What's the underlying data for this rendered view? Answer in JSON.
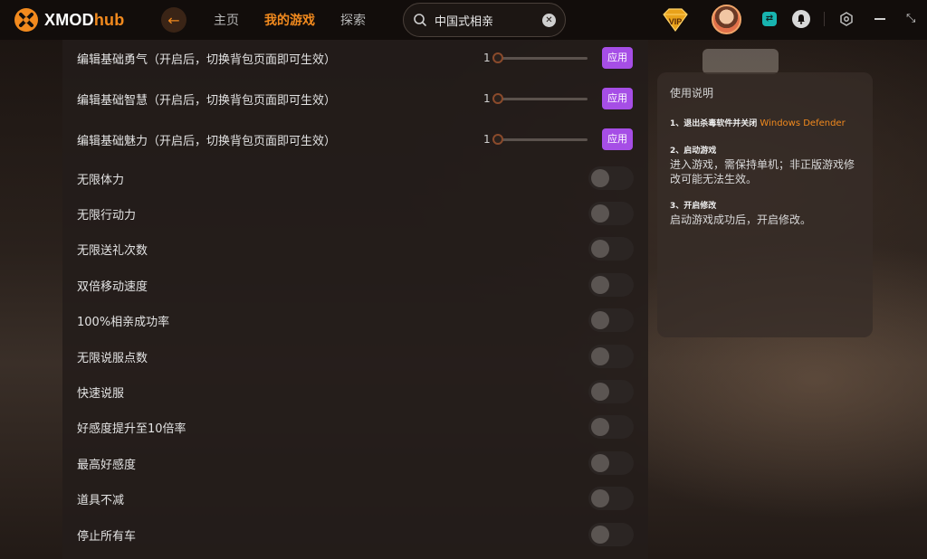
{
  "app": {
    "logo_text": "XMOD",
    "logo_hub": "hub",
    "accent_color": "#f28a1e"
  },
  "nav": {
    "items": [
      {
        "label": "主页",
        "active": false
      },
      {
        "label": "我的游戏",
        "active": true
      },
      {
        "label": "探索",
        "active": false
      }
    ]
  },
  "search": {
    "value": "中国式相亲",
    "clear_glyph": "✕"
  },
  "topbar": {
    "back_glyph": "←",
    "vip_label": "VIP",
    "sync_glyph": "⇄",
    "maximize_glyph": "⤡"
  },
  "sliders": [
    {
      "label": "编辑基础勇气（开启后，切换背包页面即可生效）",
      "value": "1",
      "apply": "应用"
    },
    {
      "label": "编辑基础智慧（开启后，切换背包页面即可生效）",
      "value": "1",
      "apply": "应用"
    },
    {
      "label": "编辑基础魅力（开启后，切换背包页面即可生效）",
      "value": "1",
      "apply": "应用"
    }
  ],
  "toggles": [
    {
      "label": "无限体力",
      "on": false
    },
    {
      "label": "无限行动力",
      "on": false
    },
    {
      "label": "无限送礼次数",
      "on": false
    },
    {
      "label": "双倍移动速度",
      "on": false
    },
    {
      "label": "100%相亲成功率",
      "on": false
    },
    {
      "label": "无限说服点数",
      "on": false
    },
    {
      "label": "快速说服",
      "on": false
    },
    {
      "label": "好感度提升至10倍率",
      "on": false
    },
    {
      "label": "最高好感度",
      "on": false
    },
    {
      "label": "道具不减",
      "on": false
    },
    {
      "label": "停止所有车",
      "on": false
    }
  ],
  "instructions": {
    "title": "使用说明",
    "step1_title": "1、退出杀毒软件并关闭",
    "step1_highlight": "Windows Defender",
    "step2_title": "2、启动游戏",
    "step2_body": "进入游戏，需保持单机；非正版游戏修改可能无法生效。",
    "step3_title": "3、开启修改",
    "step3_body": "启动游戏成功后，开启修改。"
  }
}
